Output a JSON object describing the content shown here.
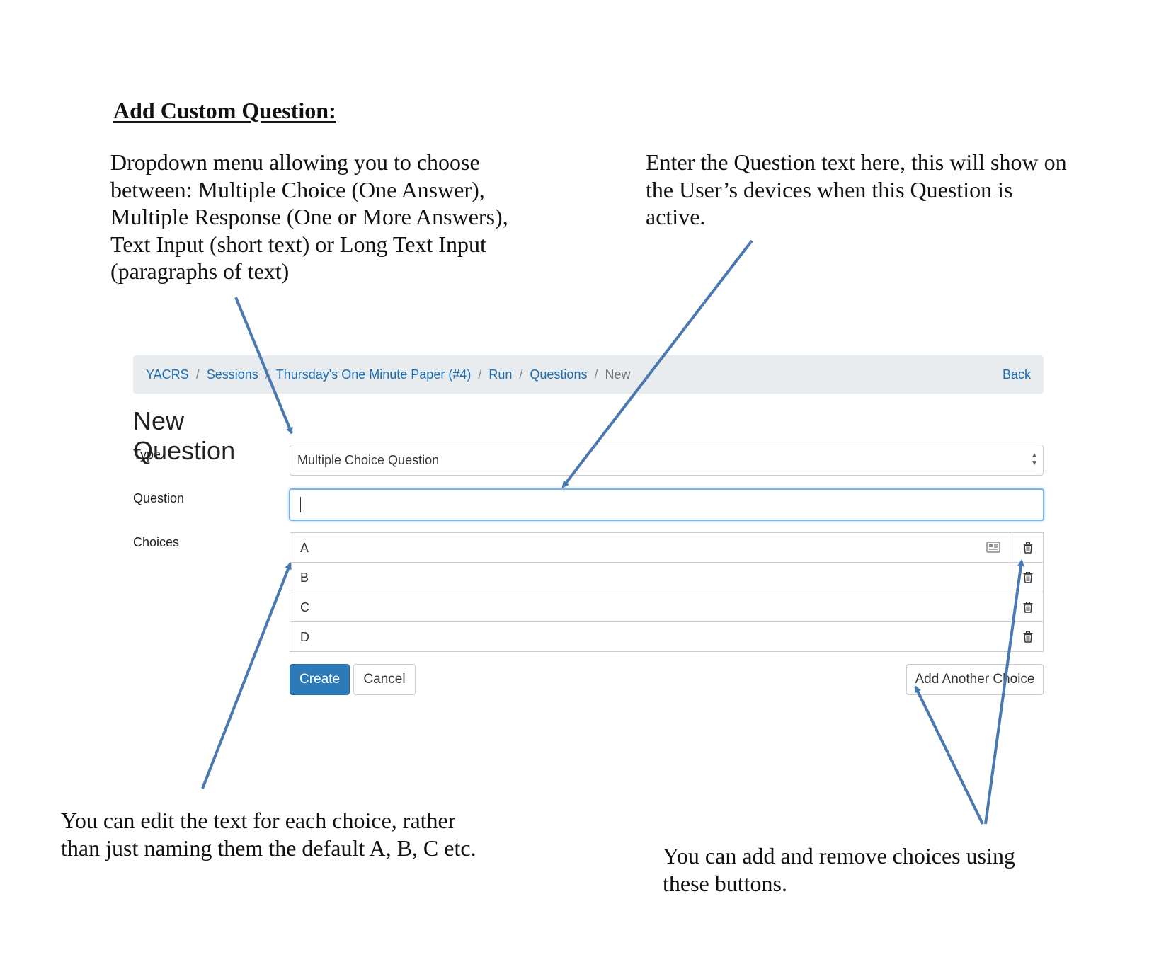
{
  "document": {
    "heading": "Add Custom Question:",
    "notes": {
      "type": "Dropdown menu allowing you to choose between: Multiple Choice (One Answer), Multiple Response (One or More Answers), Text Input (short text) or Long Text Input (paragraphs of text)",
      "question": "Enter the Question text here, this will show on the User’s devices when this Question is active.",
      "choices": "You can edit the text for each choice, rather than just naming them the default A, B, C etc.",
      "buttons": "You can add and remove choices using these buttons."
    },
    "arrow_color": "#4a78b0"
  },
  "ui": {
    "breadcrumb": {
      "items": [
        "YACRS",
        "Sessions",
        "Thursday's One Minute Paper (#4)",
        "Run",
        "Questions"
      ],
      "separator": "/",
      "current": "New",
      "back_label": "Back"
    },
    "page_title": "New Question",
    "form": {
      "type_label": "Type",
      "type_value": "Multiple Choice Question",
      "question_label": "Question",
      "question_value": "",
      "choices_label": "Choices",
      "choices": [
        "A",
        "B",
        "C",
        "D"
      ]
    },
    "buttons": {
      "create": "Create",
      "cancel": "Cancel",
      "add_choice": "Add Another Choice"
    },
    "colors": {
      "link": "#1a6fb5",
      "primary_button": "#2c7ab8",
      "breadcrumb_bg": "#e9ecef",
      "focus_border": "#7fb3e6"
    }
  }
}
